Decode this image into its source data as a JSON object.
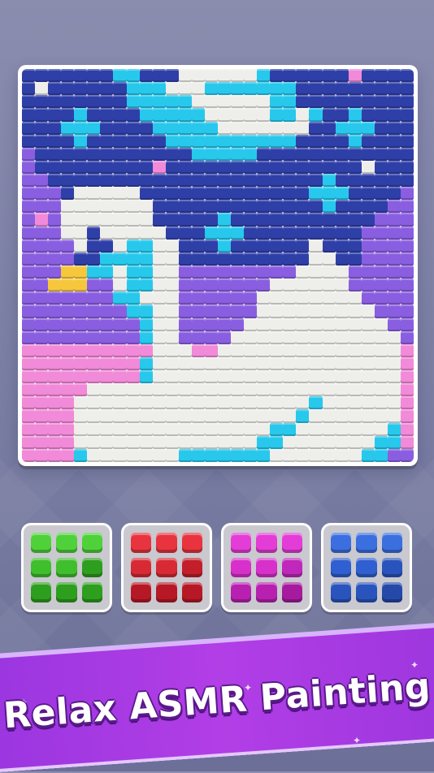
{
  "slogan": "Relax ASMR Painting",
  "colors": {
    "D": "#2f3fa8",
    "C": "#27c8ec",
    "W": "#eeeeea",
    "P": "#8a5ee0",
    "K": "#f18ad8",
    "Y": "#f6c73c",
    "M": "#f28ae0"
  },
  "board_rows": [
    "DDDDDDDCCDDDWWWWWWCDDDDDDKDDDD",
    "DWDDDDDDCCCWWWCCCCCCCDDDDDDDDD",
    "DDDDDDDDCCCCCWWWWWWCCDDDDDDDDD",
    "DDDDCDDDDCCCCCWWWWWCCWCDDCDDDD",
    "DDDCCCDDDDCCCCCWWWWWWWDDCCCDDD",
    "DDDDCDDDDDDCCCCCCCCCCDDDDCDDDD",
    "PDDDDDDDDDDDDCCCCCDDDDDDDDDDDD",
    "PDDDDDDDDDKDDDDDDDDDDDDDDDWDDD",
    "PPDDDDDDDDDDDDDDDDDDDDDCDDDDDD",
    "PPPDWWWWWDDDDDDDDDDDDDCCCDDDDP",
    "PPPWWWWWWWDDDDDDDDDDDDDCDDDDPP",
    "PKPWWWWWWWDDDDDCDDDDDDDDDDDPPP",
    "PPPWWDWWWWWDDDCCCDDDDDDDDDPPPP",
    "PPPPWDDWCCWWDDDCDDDDDDWDDDPPPP",
    "PPPPDDCCCCWWDDDDDDDDDDWWDDPPPP",
    "PPPYYCCWCCWWPPPPPPPPPWWWWPPPPP",
    "PPYYYPPWCCWWPPPPPPPWWWWWWPPPPP",
    "PPPPPPPCCWWWPPPPPPWWWWWWWWPPPP",
    "PPPPPPPPCCWWPPPPPPWWWWWWWWWPPP",
    "PPPPPPPPPCWWPPPPPWWWWWWWWWWWPP",
    "PPPPPPPPPCWWPPPPWWWWWWWWWWWWWP",
    "KKKKKKKKKKWWWKKWWWWWWWWWWWWWWK",
    "KKKKKKKKKCWWWWWWWWWWWWWWWWWWWK",
    "KKKKKKKKKCWWWWWWWWWWWWWWWWWWWK",
    "KKKKKWWWWWWWWWWWWWWWWWWWWWWWWK",
    "KKKKWWWWWWWWWWWWWWWWWWCWWWWWWK",
    "KKKKWWWWWWWWWWWWWWWWWCWWWWWWWK",
    "KKKKWWWWWWWWWWWWWWWCCWWWWWWWCK",
    "KKKKWWWWWWWWWWWWWWCCWWWWWWWCCK",
    "KKKKCWWWWWWWCCCCCCCWWWWWWWCCPP"
  ],
  "palettes": [
    {
      "name": "green",
      "swatches": [
        "#4fd13a",
        "#4fd13a",
        "#4fd13a",
        "#3fbf2c",
        "#3fbf2c",
        "#2e9e1e",
        "#2e9e1e",
        "#2e9e1e",
        "#2e9e1e"
      ]
    },
    {
      "name": "red",
      "swatches": [
        "#e8343e",
        "#e8343e",
        "#e8343e",
        "#d82a34",
        "#d82a34",
        "#c41e2a",
        "#b71826",
        "#b71826",
        "#b71826"
      ]
    },
    {
      "name": "magenta",
      "swatches": [
        "#e43cd6",
        "#e43cd6",
        "#e43cd6",
        "#d830ca",
        "#d830ca",
        "#c028bb",
        "#b820b0",
        "#b820b0",
        "#a61a9e"
      ]
    },
    {
      "name": "blue",
      "swatches": [
        "#3b6fe0",
        "#3b6fe0",
        "#3b6fe0",
        "#2f5fd0",
        "#2f5fd0",
        "#2a54bd",
        "#2a54bd",
        "#2a54bd",
        "#2449a8"
      ]
    }
  ]
}
